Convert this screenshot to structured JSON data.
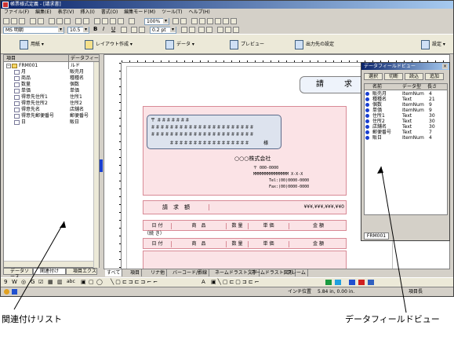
{
  "window": {
    "title": "帳票様式定義 - [請求書]"
  },
  "menu": [
    "ファイル(F)",
    "編集(E)",
    "表示(V)",
    "挿入(I)",
    "書式(O)",
    "編集モード(M)",
    "ツール(T)",
    "ヘルプ(H)"
  ],
  "toolbar": {
    "zoom_value": "100%",
    "font_value": "MS 明朝",
    "size_value": "10.5",
    "bold": "B",
    "italic": "I",
    "underline": "U",
    "strike": "abe",
    "line_value": "0.2 pt"
  },
  "big_toolbar": {
    "paper": "用紙",
    "layout": "レイアウト作成",
    "data": "データ",
    "preview": "プレビュー",
    "output": "出力先の設定",
    "settings": "設定"
  },
  "left_pane": {
    "col_item": "項目",
    "col_field": "データフィールド",
    "root": "FRM001",
    "rows": [
      {
        "name": "月",
        "field": "販売月"
      },
      {
        "name": "商品",
        "field": "種種名"
      },
      {
        "name": "数量",
        "field": "個数"
      },
      {
        "name": "単価",
        "field": "単価"
      },
      {
        "name": "得意先住所1",
        "field": "住所1"
      },
      {
        "name": "得意先住所2",
        "field": "住所2"
      },
      {
        "name": "得意先名",
        "field": "店舗名"
      },
      {
        "name": "得意先郵便番号",
        "field": "郵便番号"
      },
      {
        "name": "日",
        "field": "販日"
      }
    ],
    "tabs": [
      "データソース",
      "関連付け",
      "項目エクス"
    ]
  },
  "document": {
    "title": "請　求",
    "address_lines": [
      "〒 ＃＃＃＃＃＃＃",
      "＃＃＃＃＃＃＃＃＃＃＃＃＃＃＃＃＃＃＃＃＃＃",
      "＃＃＃＃＃＃＃＃＃＃＃＃＃＃＃＃＃＃＃＃＃＃"
    ],
    "customer": "＃＃＃＃＃＃＃＃＃＃＃＃＃＃＃＃＃",
    "honorific": "様",
    "company": "○○○株式会社",
    "company_zip": "〒 000-0000",
    "company_addr": "MMMMMMMMMMMMMMM X-X-X",
    "tel": "Tel:(00)0000-0000",
    "fax": "Fax:(00)0000-0000",
    "amount_label": "請　求　額",
    "amount_value": "¥¥¥,¥¥¥,¥¥¥,¥¥0",
    "cols": [
      "日 付",
      "商　品",
      "数 量",
      "単 価",
      "金 額"
    ],
    "cont": "（続 き）"
  },
  "dfv": {
    "title": "データフィールドビュー",
    "buttons": [
      "選択",
      "切断",
      "読込",
      "追加"
    ],
    "headers": [
      "名前",
      "データ型",
      "長さ"
    ],
    "rows": [
      {
        "name": "販売月",
        "type": "ItemNum",
        "len": "4"
      },
      {
        "name": "種種名",
        "type": "Text",
        "len": "21"
      },
      {
        "name": "個数",
        "type": "ItemNum",
        "len": "9"
      },
      {
        "name": "単価",
        "type": "ItemNum",
        "len": "9"
      },
      {
        "name": "住所1",
        "type": "Text",
        "len": "30"
      },
      {
        "name": "住所2",
        "type": "Text",
        "len": "30"
      },
      {
        "name": "店舗名",
        "type": "Text",
        "len": "30"
      },
      {
        "name": "郵便番号",
        "type": "Text",
        "len": "7"
      },
      {
        "name": "販日",
        "type": "ItemNum",
        "len": "4"
      }
    ],
    "tab": "FRM001"
  },
  "bottom_tabs": [
    "すべて",
    "項目",
    "リナ他",
    "バーコード/罫線",
    "ネームドラスト文字",
    "ネームドラスト図形",
    "フレーム"
  ],
  "status": {
    "coords_label": "位置",
    "coords": "5.84 in,  0.00 in.",
    "mode": "インチ",
    "right": "項目長"
  },
  "callouts": {
    "left": "関連付けリスト",
    "right": "データフィールドビュー"
  }
}
